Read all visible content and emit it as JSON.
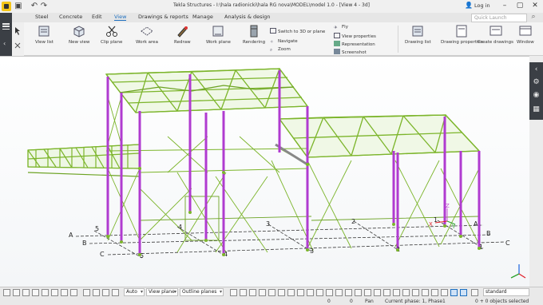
{
  "app": {
    "window_title": "Tekla Structures - I:\\hala radionicki\\hala RG nova\\MODEL\\model 1.0  - [View 4 - 3d]",
    "search_placeholder": "Quick Launch",
    "login_label": "Log in"
  },
  "menu_tabs": [
    {
      "label": "Steel",
      "active": false
    },
    {
      "label": "Concrete",
      "active": false
    },
    {
      "label": "Edit",
      "active": false
    },
    {
      "label": "View",
      "active": true
    },
    {
      "label": "Drawings & reports",
      "active": false
    },
    {
      "label": "Manage",
      "active": false
    },
    {
      "label": "Analysis & design",
      "active": false
    }
  ],
  "ribbon": {
    "view_list": "View list",
    "new_view": "New view",
    "clip_plane": "Clip plane",
    "work_area": "Work area",
    "redraw": "Redraw",
    "work_plane": "Work plane",
    "rendering": "Rendering",
    "switch_3d": "Switch to 3D or plane",
    "navigate": "Navigate",
    "zoom": "Zoom",
    "fly": "Fly",
    "view_properties": "View properties",
    "representation": "Representation",
    "screenshot": "Screenshot",
    "drawing_list": "Drawing list",
    "drawing_properties": "Drawing properties",
    "create_drawings": "Create drawings",
    "window": "Window"
  },
  "grid_labels": {
    "rows": [
      "A",
      "B",
      "C"
    ],
    "rows_right": [
      "A",
      "B",
      "C"
    ],
    "cols": [
      "5",
      "4",
      "3",
      "2",
      "1"
    ],
    "cols_back": [
      "5",
      "4",
      "3",
      "2",
      "1"
    ]
  },
  "axis_labels": {
    "x": "X",
    "y": "Y",
    "z": "Z"
  },
  "statusbar": {
    "snap_mode": "Auto",
    "plane_mode": "View plane",
    "outline_mode": "Outline planes",
    "setting": "standard",
    "count_left": "0",
    "count_mid": "0",
    "pan": "Pan",
    "phase": "Current phase: 1, Phase1",
    "selection": "0 + 0 objects selected"
  },
  "colors": {
    "steel_beam": "#7cb52b",
    "column": "#b03bd0",
    "gridline": "#3b3b3b",
    "axis_x": "#e0202a",
    "axis_y": "#2aa12a",
    "axis_z": "#c050d0",
    "accent": "#1e6fbf"
  }
}
